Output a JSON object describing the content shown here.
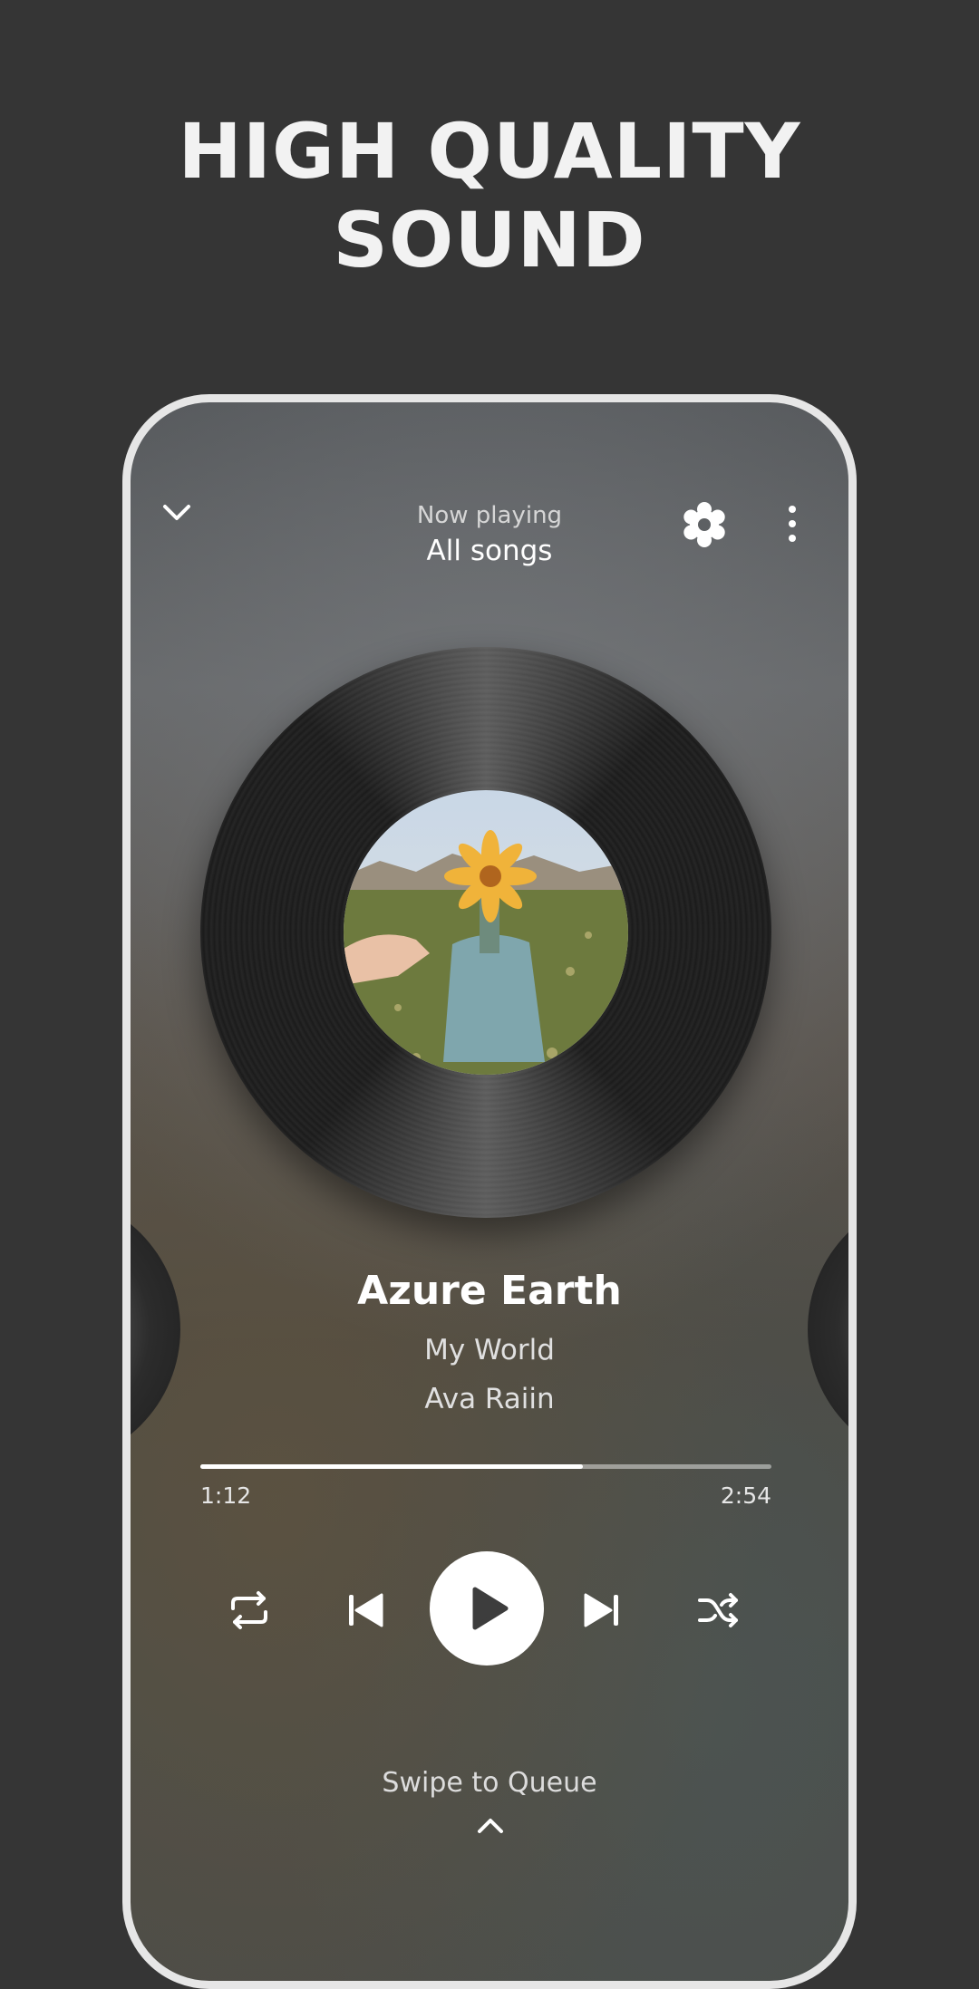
{
  "headline": {
    "line1": "HIGH QUALITY",
    "line2": "SOUND"
  },
  "header": {
    "label": "Now playing",
    "title": "All songs",
    "icons": [
      "chevron-down-icon",
      "settings-icon",
      "more-vertical-icon"
    ]
  },
  "track": {
    "title": "Azure Earth",
    "album": "My World",
    "artist": "Ava Raiin"
  },
  "progress": {
    "current": "1:12",
    "total": "2:54",
    "fraction": 0.67
  },
  "controls": [
    "repeat-icon",
    "previous-icon",
    "play-icon",
    "next-icon",
    "shuffle-icon"
  ],
  "queue": {
    "label": "Swipe to Queue"
  },
  "colors": {
    "background": "#353535",
    "accent": "#ffffff"
  }
}
